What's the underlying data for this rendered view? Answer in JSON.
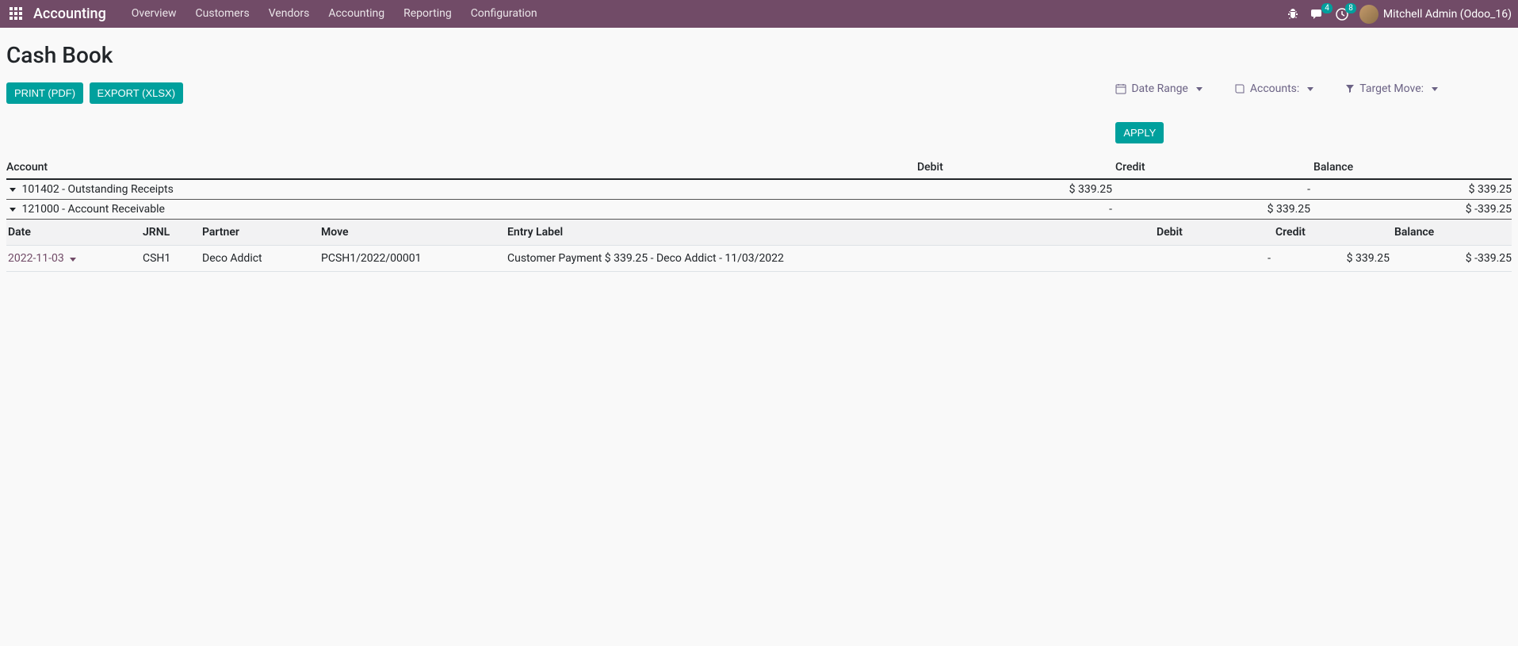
{
  "nav": {
    "brand": "Accounting",
    "links": [
      "Overview",
      "Customers",
      "Vendors",
      "Accounting",
      "Reporting",
      "Configuration"
    ],
    "msg_badge": "4",
    "activity_badge": "8",
    "user": "Mitchell Admin (Odoo_16)"
  },
  "page": {
    "title": "Cash Book",
    "print_btn": "PRINT (PDF)",
    "export_btn": "EXPORT (XLSX)",
    "apply_btn": "APPLY"
  },
  "filters": {
    "date_range": "Date Range",
    "accounts": "Accounts:",
    "target_move": "Target Move:"
  },
  "summary": {
    "headers": {
      "account": "Account",
      "debit": "Debit",
      "credit": "Credit",
      "balance": "Balance"
    },
    "rows": [
      {
        "account": "101402 - Outstanding Receipts",
        "debit": "$ 339.25",
        "credit": "-",
        "balance": "$ 339.25"
      },
      {
        "account": "121000 - Account Receivable",
        "debit": "-",
        "credit": "$ 339.25",
        "balance": "$ -339.25"
      }
    ]
  },
  "detail": {
    "headers": {
      "date": "Date",
      "jrnl": "JRNL",
      "partner": "Partner",
      "move": "Move",
      "entry_label": "Entry Label",
      "debit": "Debit",
      "credit": "Credit",
      "balance": "Balance"
    },
    "rows": [
      {
        "date": "2022-11-03",
        "jrnl": "CSH1",
        "partner": "Deco Addict",
        "move": "PCSH1/2022/00001",
        "entry_label": "Customer Payment $ 339.25 - Deco Addict - 11/03/2022",
        "debit": "-",
        "credit": "$ 339.25",
        "balance": "$ -339.25"
      }
    ]
  }
}
